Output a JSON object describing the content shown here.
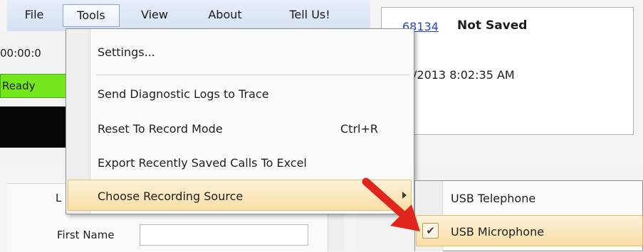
{
  "menubar": {
    "items": [
      "File",
      "Tools",
      "View",
      "About",
      "Tell Us!"
    ],
    "active": "Tools"
  },
  "status": {
    "timer": "00:00:0",
    "ready": "Ready"
  },
  "form": {
    "label_partial": "L",
    "first_name_label": "First Name",
    "first_name_value": ""
  },
  "call": {
    "id_link": "68134",
    "save_status": "Not Saved",
    "datetime_partial": "/2013 8:02:35 AM"
  },
  "tools_menu": {
    "items": [
      {
        "label": "Settings..."
      },
      {
        "label": "Send Diagnostic Logs to Trace"
      },
      {
        "label": "Reset To Record Mode",
        "shortcut": "Ctrl+R"
      },
      {
        "label": "Export Recently Saved Calls To Excel"
      },
      {
        "label": "Choose Recording Source",
        "has_submenu": true,
        "highlighted": true
      }
    ]
  },
  "recording_source_menu": {
    "items": [
      {
        "label": "USB Telephone",
        "checked": false
      },
      {
        "label": "USB Microphone",
        "checked": true,
        "highlighted": true
      }
    ],
    "check_glyph": "✔"
  },
  "colors": {
    "ready_green": "#74e61c",
    "menu_highlight": "#f9dfa6",
    "arrow_red": "#e0261c",
    "link_blue": "#2447c6"
  },
  "icons": {
    "annotation": "red-arrow-icon",
    "submenu": "chevron-right-icon",
    "check": "checkmark-icon"
  }
}
